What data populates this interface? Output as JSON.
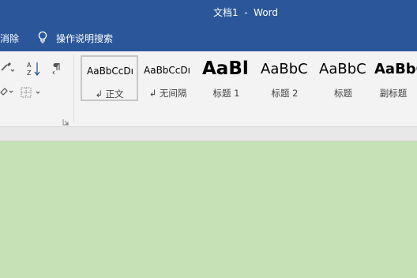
{
  "window": {
    "title": "文档1  -  Word"
  },
  "tabs": {
    "partial_label": "消除"
  },
  "tellme": {
    "label": "操作说明搜索"
  },
  "ribbon": {
    "paragraph_tools": [
      {
        "name": "borders-dropdown",
        "icon": "borders-icon"
      },
      {
        "name": "sort-button",
        "icon": "sort-az-icon"
      },
      {
        "name": "show-marks-button",
        "icon": "pilcrow-icon"
      },
      {
        "name": "shading-dropdown",
        "icon": "shading-icon"
      }
    ],
    "styles": [
      {
        "sample": "AaBbCcDı",
        "name": "↲ 正文",
        "selected": true
      },
      {
        "sample": "AaBbCcDı",
        "name": "↲ 无间隔",
        "selected": false
      },
      {
        "sample": "AaBl",
        "name": "标题 1",
        "selected": false
      },
      {
        "sample": "AaBbC",
        "name": "标题 2",
        "selected": false
      },
      {
        "sample": "AaBbC",
        "name": "标题",
        "selected": false
      },
      {
        "sample": "AaBbC",
        "name": "副标题",
        "selected": false
      }
    ]
  },
  "colors": {
    "titlebar": "#2b579a",
    "ribbon": "#f3f3f3",
    "document_background": "#c5e1b5",
    "selected_tile_border": "#c6c6c6"
  }
}
